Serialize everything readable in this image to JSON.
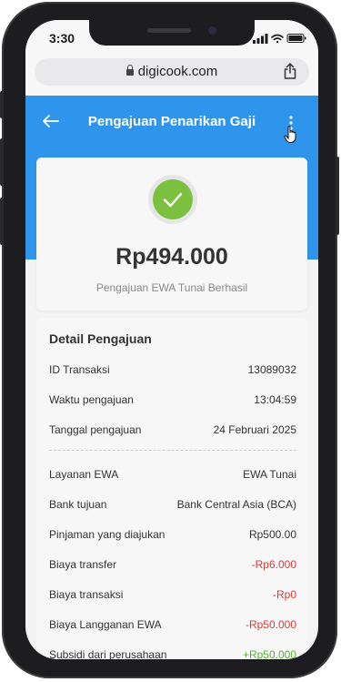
{
  "status_bar": {
    "time": "3:30"
  },
  "browser": {
    "url": "digicook.com"
  },
  "header": {
    "title": "Pengajuan Penarikan Gaji"
  },
  "summary": {
    "amount": "Rp494.000",
    "status_text": "Pengajuan EWA Tunai Berhasil"
  },
  "detail": {
    "title": "Detail Pengajuan",
    "rows": [
      {
        "label": "ID Transaksi",
        "value": "13089032"
      },
      {
        "label": "Waktu pengajuan",
        "value": "13:04:59"
      },
      {
        "label": "Tanggal pengajuan",
        "value": "24 Februari 2025"
      },
      {
        "label": "Layanan EWA",
        "value": "EWA Tunai"
      },
      {
        "label": "Bank tujuan",
        "value": "Bank Central Asia (BCA)"
      },
      {
        "label": "Pinjaman yang diajukan",
        "value": "Rp500.00"
      },
      {
        "label": "Biaya transfer",
        "value": "-Rp6.000"
      },
      {
        "label": "Biaya transaksi",
        "value": "-Rp0"
      },
      {
        "label": "Biaya Langganan EWA",
        "value": "-Rp50.000"
      },
      {
        "label": "Subsidi dari perusahaan",
        "value": "+Rp50.000"
      }
    ]
  },
  "colors": {
    "header_blue": "#2f95ec",
    "success_green": "#7cc040",
    "negative_red": "#d83b3b",
    "positive_green": "#5fae34"
  }
}
